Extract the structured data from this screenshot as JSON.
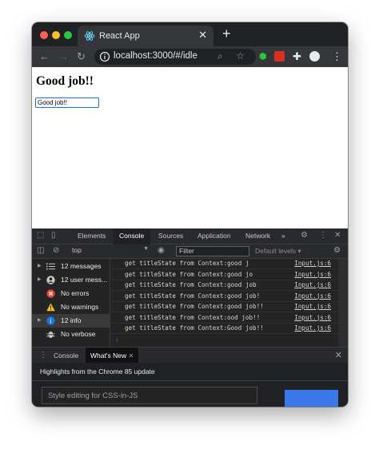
{
  "browser": {
    "tab_title": "React App",
    "url": "localhost:3000/#/idle"
  },
  "page": {
    "heading": "Good job!!",
    "input_value": "Good job!!"
  },
  "devtools": {
    "tabs": [
      "Elements",
      "Console",
      "Sources",
      "Application",
      "Network"
    ],
    "more_tabs": "»",
    "context": "top",
    "filter_placeholder": "Filter",
    "levels": "Default levels ▾",
    "sidebar": [
      {
        "label": "12 messages",
        "icon": "list-icon"
      },
      {
        "label": "12 user mess...",
        "icon": "user-icon"
      },
      {
        "label": "No errors",
        "icon": "error-icon"
      },
      {
        "label": "No warnings",
        "icon": "warning-icon"
      },
      {
        "label": "12 info",
        "icon": "info-icon"
      },
      {
        "label": "No verbose",
        "icon": "verbose-icon"
      }
    ],
    "logs": [
      {
        "msg": "get titleState from Context:good j",
        "src": "Input.js:6"
      },
      {
        "msg": "get titleState from Context:good jo",
        "src": "Input.js:6"
      },
      {
        "msg": "get titleState from Context:good job",
        "src": "Input.js:6"
      },
      {
        "msg": "get titleState from Context:good job!",
        "src": "Input.js:6"
      },
      {
        "msg": "get titleState from Context:good job!!",
        "src": "Input.js:6"
      },
      {
        "msg": "get titleState from Context:ood job!!",
        "src": "Input.js:6"
      },
      {
        "msg": "get titleState from Context:Good job!!",
        "src": "Input.js:6"
      }
    ],
    "drawer": {
      "tab_console": "Console",
      "tab_whats_new": "What's New",
      "highlights": "Highlights from the Chrome 85 update",
      "card_title": "Style editing for CSS-in-JS"
    }
  },
  "colors": {
    "accent": "#1a73e8",
    "devtools_bg": "#242424"
  }
}
